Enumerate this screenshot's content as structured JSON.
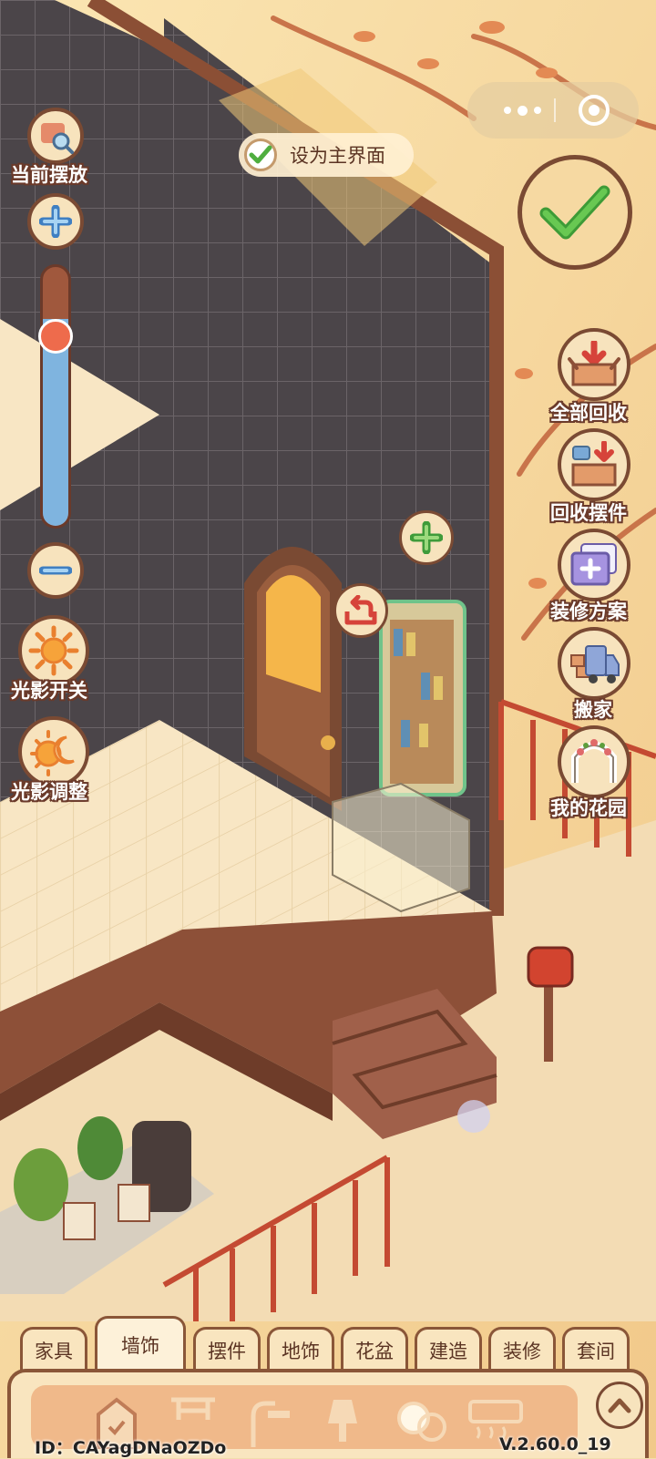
{
  "topbar": {
    "set_main_label": "设为主界面"
  },
  "left_controls": {
    "current_layout_label": "当前摆放",
    "zoom_level": 0.8,
    "light_toggle_label": "光影开关",
    "light_adjust_label": "光影调整"
  },
  "right_menu": [
    {
      "label": "全部回收",
      "icon": "recycle-all-icon"
    },
    {
      "label": "回收摆件",
      "icon": "recycle-items-icon"
    },
    {
      "label": "装修方案",
      "icon": "decoration-plan-icon"
    },
    {
      "label": "搬家",
      "icon": "moving-truck-icon"
    },
    {
      "label": "我的花园",
      "icon": "garden-arch-icon"
    }
  ],
  "tabs": [
    {
      "label": "家具"
    },
    {
      "label": "墙饰",
      "active": true
    },
    {
      "label": "摆件"
    },
    {
      "label": "地饰"
    },
    {
      "label": "花盆"
    },
    {
      "label": "建造"
    },
    {
      "label": "装修"
    },
    {
      "label": "套间"
    }
  ],
  "footer": {
    "id_text": "ID：CAYagDNaOZDo",
    "version": "V.2.60.0_19"
  },
  "colors": {
    "wall": "#4a4448",
    "floor": "#f6e2bd",
    "accent_green": "#4fae3f",
    "frame": "#7a4a33"
  }
}
